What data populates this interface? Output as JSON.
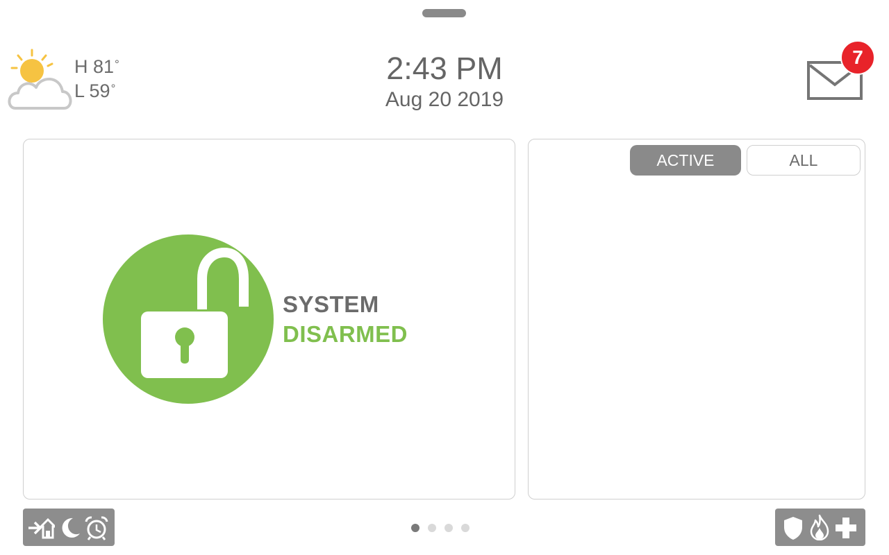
{
  "weather": {
    "high_label": "H 81",
    "low_label": "L 59",
    "degree_symbol": "°",
    "icon": "partly-cloudy-icon"
  },
  "clock": {
    "time": "2:43 PM",
    "date": "Aug 20 2019"
  },
  "messages": {
    "icon": "envelope-icon",
    "unread_count": "7"
  },
  "status": {
    "line1": "SYSTEM",
    "line2": "DISARMED",
    "icon": "unlocked-padlock-icon",
    "accent_color": "#80bf4e"
  },
  "events": {
    "tabs": [
      {
        "label": "ACTIVE",
        "selected": true
      },
      {
        "label": "ALL",
        "selected": false
      }
    ]
  },
  "arm_modes": {
    "icons": [
      "exit-home-icon",
      "moon-icon",
      "alarm-clock-icon"
    ]
  },
  "emergency": {
    "icons": [
      "shield-icon",
      "fire-icon",
      "medical-cross-icon"
    ]
  },
  "pagination": {
    "total_pages": 4,
    "current_page": 1
  },
  "colors": {
    "badge": "#e8232a",
    "button_gray": "#8d8d8d",
    "text_gray": "#6b6b6b"
  }
}
